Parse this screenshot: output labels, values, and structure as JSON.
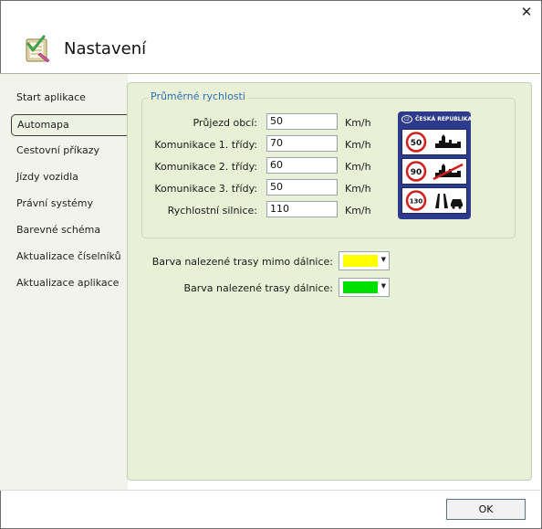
{
  "window": {
    "title": "Nastavení",
    "close_glyph": "✕"
  },
  "sidebar": {
    "items": [
      {
        "label": "Start aplikace"
      },
      {
        "label": "Automapa",
        "active": true
      },
      {
        "label": "Cestovní příkazy"
      },
      {
        "label": "Jízdy vozidla"
      },
      {
        "label": "Právní systémy"
      },
      {
        "label": "Barevné schéma"
      },
      {
        "label": "Aktualizace číselníků"
      },
      {
        "label": "Aktualizace aplikace"
      }
    ]
  },
  "speeds": {
    "group_title": "Průměrné rychlosti",
    "rows": [
      {
        "label": "Průjezd obcí:",
        "value": "50",
        "unit": "Km/h"
      },
      {
        "label": "Komunikace 1. třídy:",
        "value": "70",
        "unit": "Km/h"
      },
      {
        "label": "Komunikace 2. třídy:",
        "value": "60",
        "unit": "Km/h"
      },
      {
        "label": "Komunikace 3. třídy:",
        "value": "50",
        "unit": "Km/h"
      },
      {
        "label": "Rychlostní silnice:",
        "value": "110",
        "unit": "Km/h"
      }
    ]
  },
  "sign": {
    "country_code": "CZ",
    "title": "ČESKÁ REPUBLIKA",
    "limits": [
      "50",
      "90",
      "130"
    ]
  },
  "colors": {
    "outside_highway": {
      "label": "Barva nalezené trasy mimo dálnice:",
      "color": "#ffff00"
    },
    "highway": {
      "label": "Barva nalezené trasy dálnice:",
      "color": "#00e000"
    }
  },
  "footer": {
    "ok_label": "OK"
  },
  "icons": {
    "header": "settings-checklist-icon",
    "dropdown": "chevron-down-icon"
  }
}
